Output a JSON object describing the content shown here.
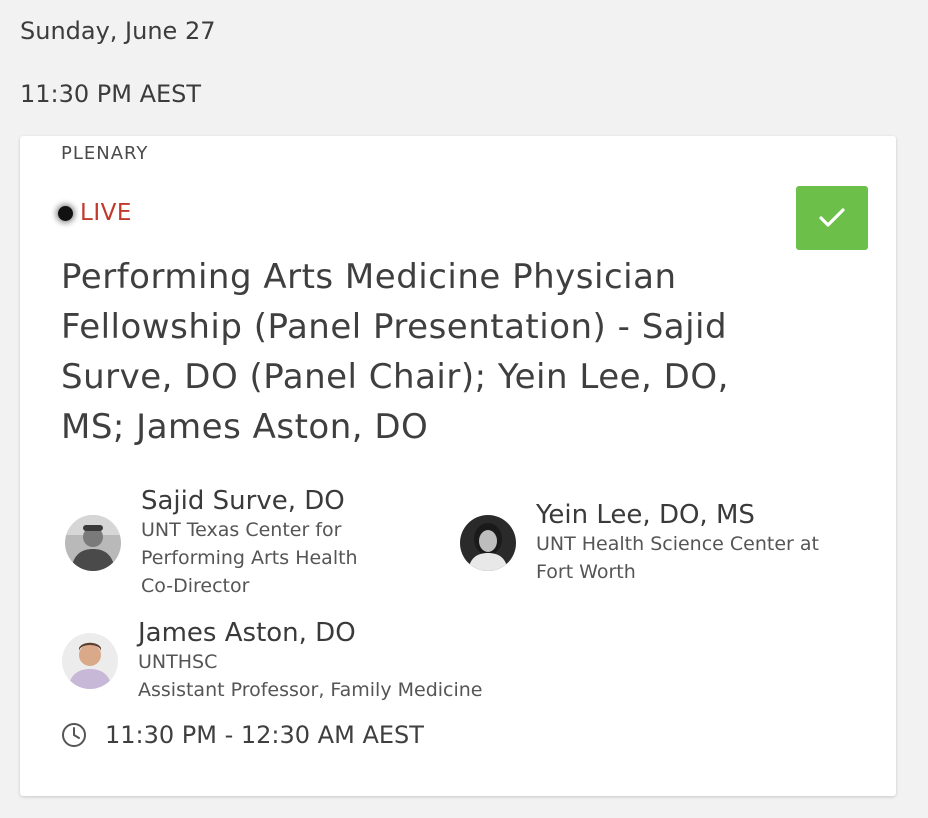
{
  "schedule": {
    "date": "Sunday, June 27",
    "time": "11:30 PM AEST"
  },
  "session": {
    "track": "PLENARY",
    "live_label": "LIVE",
    "title": "Performing Arts Medicine Physician Fellowship (Panel Presentation) - Sajid Surve, DO (Panel Chair); Yein Lee, DO, MS; James Aston, DO",
    "added_icon": "checkmark-icon",
    "time_range": "11:30 PM - 12:30 AM AEST",
    "time_icon": "clock-icon",
    "accent_color": "#6cc04a",
    "live_color": "#c0392b"
  },
  "speakers": [
    {
      "name": "Sajid Surve, DO",
      "affiliation_lines": [
        "UNT Texas Center for",
        "Performing Arts Health",
        "Co-Director"
      ]
    },
    {
      "name": "Yein Lee, DO, MS",
      "affiliation_lines": [
        "UNT Health Science Center at",
        "Fort Worth"
      ]
    },
    {
      "name": "James Aston, DO",
      "affiliation_lines": [
        "UNTHSC",
        "Assistant Professor, Family Medicine"
      ]
    }
  ]
}
